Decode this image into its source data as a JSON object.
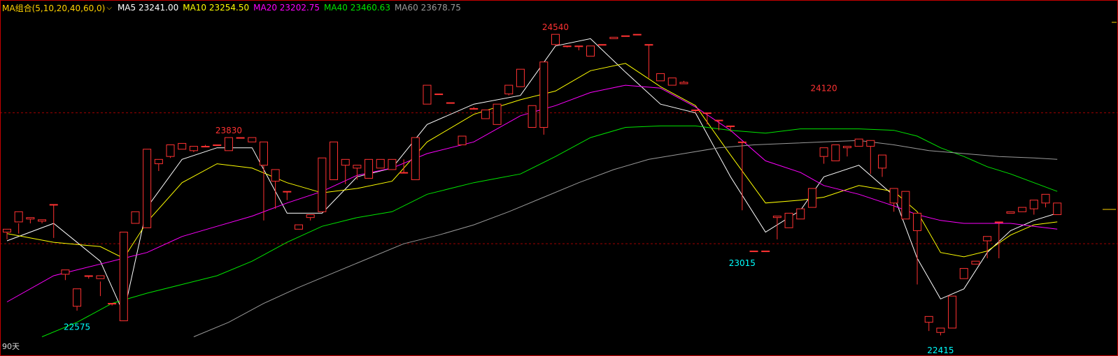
{
  "indicator": {
    "selector": "MA组合(5,10,20,40,60,0)",
    "caret": "⌵",
    "items": [
      {
        "label": "MA5",
        "value": "23241.00",
        "color": "#ffffff"
      },
      {
        "label": "MA10",
        "value": "23254.50",
        "color": "#ffff00"
      },
      {
        "label": "MA20",
        "value": "23202.75",
        "color": "#ff00ff"
      },
      {
        "label": "MA40",
        "value": "23460.63",
        "color": "#00e600"
      },
      {
        "label": "MA60",
        "value": "23678.75",
        "color": "#9a9a9a"
      }
    ]
  },
  "period_label": "90天",
  "colors": {
    "up": "#ff3232",
    "down": "#00ffff",
    "frame": "#c40000",
    "grid": "#a00000",
    "background": "#000000"
  },
  "chart_data": {
    "type": "candlestick",
    "y_range": [
      22400,
      24680
    ],
    "gridlines": [
      24000,
      23100
    ],
    "annotations": [
      {
        "label": "24540",
        "index": 47,
        "value": 24540,
        "position": "above",
        "color": "#ff3232"
      },
      {
        "label": "23830",
        "index": 19,
        "value": 23830,
        "position": "above",
        "color": "#ff3232"
      },
      {
        "label": "24120",
        "index": 70,
        "value": 24120,
        "position": "above",
        "color": "#ff3232"
      },
      {
        "label": "23015",
        "index": 63,
        "value": 23015,
        "position": "below",
        "color": "#00ffff"
      },
      {
        "label": "22575",
        "index": 6,
        "value": 22575,
        "position": "below",
        "color": "#00ffff"
      },
      {
        "label": "22415",
        "index": 80,
        "value": 22415,
        "position": "below",
        "color": "#00ffff"
      }
    ],
    "candles": [
      [
        23180,
        23190,
        23130,
        23200
      ],
      [
        23250,
        23240,
        23170,
        23320
      ],
      [
        23270,
        23275,
        23240,
        23280
      ],
      [
        23255,
        23260,
        23240,
        23265
      ],
      [
        23370,
        23370,
        23140,
        23370
      ],
      [
        22890,
        22900,
        22850,
        22920
      ],
      [
        22670,
        22730,
        22640,
        22790
      ],
      [
        22880,
        22880,
        22860,
        22880
      ],
      [
        22860,
        22840,
        22740,
        22880
      ],
      [
        22690,
        22690,
        22675,
        22690
      ],
      [
        22570,
        23070,
        22570,
        23180
      ],
      [
        23240,
        23240,
        23320,
        23320
      ],
      [
        23210,
        23640,
        23210,
        23750
      ],
      [
        23650,
        23650,
        23600,
        23680
      ],
      [
        23700,
        23700,
        23690,
        23780
      ],
      [
        23750,
        23750,
        23760,
        23790
      ],
      [
        23740,
        23740,
        23730,
        23770
      ],
      [
        23770,
        23770,
        23780,
        23770
      ],
      [
        23780,
        23780,
        23780,
        23780
      ],
      [
        23740,
        23740,
        23830,
        23830
      ],
      [
        23830,
        23830,
        23830,
        23830
      ],
      [
        23800,
        23800,
        23830,
        23830
      ],
      [
        23640,
        23640,
        23260,
        23800
      ],
      [
        23530,
        23530,
        23340,
        23610
      ],
      [
        23460,
        23460,
        23400,
        23460
      ],
      [
        23200,
        23200,
        23200,
        23230
      ],
      [
        23280,
        23280,
        23260,
        23300
      ],
      [
        23320,
        23320,
        23620,
        23690
      ],
      [
        23540,
        23540,
        23760,
        23800
      ],
      [
        23640,
        23640,
        23510,
        23680
      ],
      [
        23620,
        23620,
        23540,
        23640
      ],
      [
        23550,
        23550,
        23630,
        23680
      ],
      [
        23620,
        23620,
        23620,
        23680
      ],
      [
        23610,
        23610,
        23680,
        23680
      ],
      [
        23590,
        23590,
        23680,
        23590
      ],
      [
        23540,
        23540,
        23800,
        23830
      ],
      [
        24060,
        24060,
        24190,
        24190
      ],
      [
        24130,
        24130,
        24130,
        24130
      ],
      [
        24070,
        24070,
        24070,
        24070
      ],
      [
        23780,
        23780,
        23840,
        23840
      ],
      [
        24030,
        24030,
        24040,
        24030
      ],
      [
        23960,
        23960,
        24020,
        24020
      ],
      [
        23920,
        23920,
        24060,
        24060
      ],
      [
        24130,
        24130,
        24120,
        24190
      ],
      [
        24180,
        24180,
        24300,
        24300
      ],
      [
        23900,
        23900,
        24050,
        24050
      ],
      [
        23900,
        24350,
        23850,
        24350
      ],
      [
        24470,
        24470,
        24460,
        24540
      ],
      [
        24460,
        24460,
        24450,
        24460
      ],
      [
        24460,
        24460,
        24430,
        24460
      ],
      [
        24390,
        24390,
        24400,
        24460
      ],
      [
        24470,
        24470,
        24470,
        24470
      ],
      [
        24510,
        24510,
        24520,
        24520
      ],
      [
        24530,
        24530,
        24530,
        24530
      ],
      [
        24540,
        24540,
        24540,
        24540
      ],
      [
        24470,
        24470,
        24240,
        24470
      ],
      [
        24220,
        24220,
        24260,
        24270
      ],
      [
        24190,
        24190,
        24240,
        24240
      ],
      [
        24200,
        24200,
        24220,
        24210
      ],
      [
        24020,
        24020,
        24000,
        24020
      ],
      [
        24000,
        24000,
        23920,
        24000
      ],
      [
        23950,
        23950,
        23880,
        23950
      ],
      [
        23910,
        23910,
        23870,
        23910
      ],
      [
        23800,
        23800,
        23330,
        23800
      ],
      [
        23050,
        23050,
        23050,
        23050
      ],
      [
        23050,
        23050,
        23050,
        23050
      ],
      [
        23280,
        23280,
        23130,
        23290
      ],
      [
        23210,
        23210,
        23310,
        23310
      ],
      [
        23270,
        23270,
        23340,
        23340
      ],
      [
        23350,
        23350,
        23480,
        23480
      ],
      [
        23700,
        23700,
        23650,
        23760
      ],
      [
        23670,
        23670,
        23780,
        23780
      ],
      [
        23760,
        23760,
        23700,
        23770
      ],
      [
        23770,
        23770,
        23820,
        23820
      ],
      [
        23770,
        23770,
        23580,
        23810
      ],
      [
        23620,
        23620,
        23560,
        23710
      ],
      [
        23380,
        23380,
        23320,
        23480
      ],
      [
        23270,
        23270,
        23380,
        23460
      ],
      [
        23190,
        23190,
        22820,
        23310
      ],
      [
        22560,
        22560,
        22500,
        22600
      ],
      [
        22490,
        22490,
        22470,
        22520
      ],
      [
        22520,
        22520,
        22740,
        22740
      ],
      [
        22860,
        22860,
        22930,
        22930
      ],
      [
        22960,
        22960,
        22980,
        22980
      ],
      [
        23120,
        23120,
        23000,
        23150
      ],
      [
        23250,
        23250,
        23000,
        23250
      ],
      [
        23310,
        23310,
        23320,
        23320
      ],
      [
        23320,
        23320,
        23330,
        23350
      ],
      [
        23340,
        23340,
        23300,
        23400
      ],
      [
        23380,
        23380,
        23350,
        23440
      ],
      [
        23300,
        23300,
        23350,
        23380
      ]
    ],
    "ma": {
      "MA5": {
        "color": "#ffffff",
        "points": [
          [
            0,
            23120
          ],
          [
            4,
            23240
          ],
          [
            8,
            22980
          ],
          [
            10,
            22620
          ],
          [
            12,
            23350
          ],
          [
            15,
            23680
          ],
          [
            18,
            23760
          ],
          [
            21,
            23760
          ],
          [
            24,
            23310
          ],
          [
            27,
            23310
          ],
          [
            30,
            23560
          ],
          [
            33,
            23620
          ],
          [
            36,
            23920
          ],
          [
            40,
            24060
          ],
          [
            44,
            24120
          ],
          [
            47,
            24460
          ],
          [
            50,
            24510
          ],
          [
            53,
            24280
          ],
          [
            56,
            24060
          ],
          [
            59,
            24000
          ],
          [
            62,
            23560
          ],
          [
            65,
            23180
          ],
          [
            68,
            23330
          ],
          [
            70,
            23560
          ],
          [
            73,
            23640
          ],
          [
            76,
            23430
          ],
          [
            78,
            23000
          ],
          [
            80,
            22720
          ],
          [
            82,
            22790
          ],
          [
            84,
            23040
          ],
          [
            86,
            23190
          ],
          [
            88,
            23260
          ],
          [
            90,
            23310
          ]
        ]
      },
      "MA10": {
        "color": "#ffff00",
        "points": [
          [
            0,
            23170
          ],
          [
            4,
            23110
          ],
          [
            8,
            23080
          ],
          [
            10,
            23000
          ],
          [
            12,
            23250
          ],
          [
            15,
            23520
          ],
          [
            18,
            23650
          ],
          [
            21,
            23620
          ],
          [
            24,
            23520
          ],
          [
            27,
            23450
          ],
          [
            30,
            23480
          ],
          [
            33,
            23530
          ],
          [
            36,
            23800
          ],
          [
            40,
            23990
          ],
          [
            44,
            24090
          ],
          [
            47,
            24150
          ],
          [
            50,
            24290
          ],
          [
            53,
            24340
          ],
          [
            56,
            24180
          ],
          [
            59,
            24050
          ],
          [
            62,
            23710
          ],
          [
            65,
            23380
          ],
          [
            68,
            23400
          ],
          [
            70,
            23420
          ],
          [
            73,
            23500
          ],
          [
            76,
            23460
          ],
          [
            78,
            23320
          ],
          [
            80,
            23040
          ],
          [
            82,
            23010
          ],
          [
            84,
            23050
          ],
          [
            86,
            23160
          ],
          [
            88,
            23230
          ],
          [
            90,
            23250
          ]
        ]
      },
      "MA20": {
        "color": "#ff00ff",
        "points": [
          [
            0,
            22700
          ],
          [
            4,
            22880
          ],
          [
            8,
            22960
          ],
          [
            10,
            23000
          ],
          [
            12,
            23040
          ],
          [
            15,
            23150
          ],
          [
            18,
            23220
          ],
          [
            21,
            23290
          ],
          [
            24,
            23380
          ],
          [
            27,
            23460
          ],
          [
            30,
            23570
          ],
          [
            33,
            23620
          ],
          [
            36,
            23720
          ],
          [
            40,
            23800
          ],
          [
            44,
            23980
          ],
          [
            47,
            24050
          ],
          [
            50,
            24140
          ],
          [
            53,
            24190
          ],
          [
            56,
            24170
          ],
          [
            59,
            24040
          ],
          [
            62,
            23880
          ],
          [
            65,
            23670
          ],
          [
            68,
            23590
          ],
          [
            70,
            23500
          ],
          [
            73,
            23440
          ],
          [
            76,
            23360
          ],
          [
            78,
            23300
          ],
          [
            80,
            23260
          ],
          [
            82,
            23240
          ],
          [
            84,
            23240
          ],
          [
            86,
            23240
          ],
          [
            88,
            23220
          ],
          [
            90,
            23200
          ]
        ]
      },
      "MA40": {
        "color": "#00e600",
        "points": [
          [
            3,
            22460
          ],
          [
            6,
            22560
          ],
          [
            9,
            22690
          ],
          [
            12,
            22760
          ],
          [
            15,
            22820
          ],
          [
            18,
            22880
          ],
          [
            21,
            22980
          ],
          [
            24,
            23110
          ],
          [
            27,
            23220
          ],
          [
            30,
            23280
          ],
          [
            33,
            23320
          ],
          [
            36,
            23440
          ],
          [
            40,
            23520
          ],
          [
            44,
            23580
          ],
          [
            47,
            23700
          ],
          [
            50,
            23830
          ],
          [
            53,
            23900
          ],
          [
            56,
            23910
          ],
          [
            59,
            23910
          ],
          [
            62,
            23880
          ],
          [
            65,
            23860
          ],
          [
            68,
            23890
          ],
          [
            70,
            23890
          ],
          [
            73,
            23890
          ],
          [
            76,
            23880
          ],
          [
            78,
            23840
          ],
          [
            80,
            23760
          ],
          [
            82,
            23700
          ],
          [
            84,
            23630
          ],
          [
            86,
            23580
          ],
          [
            88,
            23520
          ],
          [
            90,
            23460
          ]
        ]
      },
      "MA60": {
        "color": "#9a9a9a",
        "points": [
          [
            16,
            22460
          ],
          [
            19,
            22560
          ],
          [
            22,
            22690
          ],
          [
            25,
            22800
          ],
          [
            28,
            22900
          ],
          [
            31,
            23000
          ],
          [
            34,
            23100
          ],
          [
            37,
            23160
          ],
          [
            40,
            23230
          ],
          [
            43,
            23320
          ],
          [
            46,
            23420
          ],
          [
            49,
            23520
          ],
          [
            52,
            23610
          ],
          [
            55,
            23680
          ],
          [
            58,
            23720
          ],
          [
            61,
            23760
          ],
          [
            64,
            23780
          ],
          [
            67,
            23790
          ],
          [
            70,
            23800
          ],
          [
            73,
            23810
          ],
          [
            76,
            23780
          ],
          [
            79,
            23740
          ],
          [
            82,
            23720
          ],
          [
            85,
            23700
          ],
          [
            88,
            23690
          ],
          [
            90,
            23680
          ]
        ]
      }
    }
  }
}
